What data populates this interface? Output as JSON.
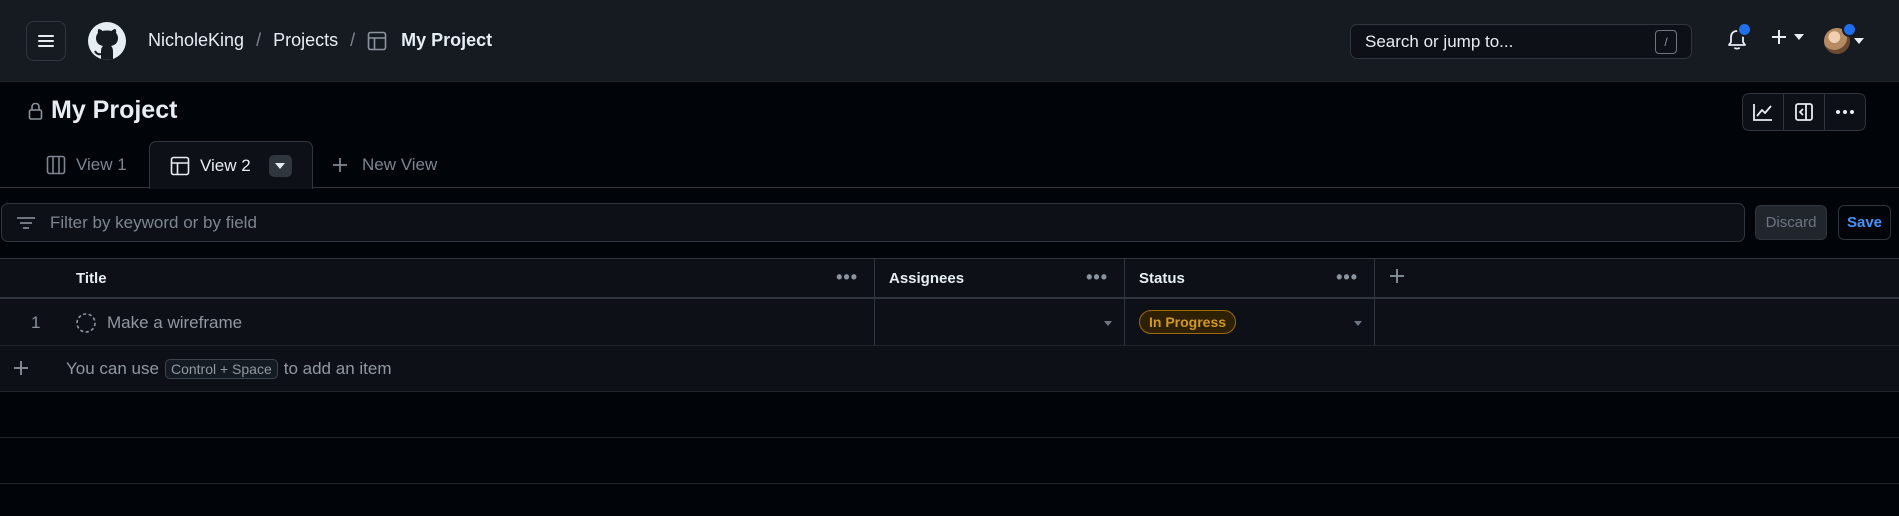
{
  "header": {
    "breadcrumbs": [
      "NicholeKing",
      "Projects",
      "My Project"
    ],
    "search_placeholder": "Search or jump to...",
    "search_shortcut": "/",
    "icons": [
      "hamburger-icon",
      "github-logo-icon",
      "table-icon",
      "bell-icon",
      "plus-icon",
      "chevron-down-icon",
      "avatar"
    ]
  },
  "project": {
    "title": "My Project",
    "visibility_icon": "lock-icon",
    "toolbar_icons": [
      "insights-icon",
      "sidebar-panel-icon",
      "kebab-horizontal-icon"
    ]
  },
  "views": {
    "tabs": [
      {
        "label": "View 1",
        "icon": "board-icon",
        "active": false
      },
      {
        "label": "View 2",
        "icon": "table-icon",
        "active": true
      }
    ],
    "new_view_label": "New View"
  },
  "filter": {
    "placeholder": "Filter by keyword or by field",
    "discard_label": "Discard",
    "save_label": "Save"
  },
  "table": {
    "columns": [
      "Title",
      "Assignees",
      "Status"
    ],
    "rows": [
      {
        "number": "1",
        "title": "Make a wireframe",
        "assignees": "",
        "status": "In Progress"
      }
    ],
    "add_hint": {
      "prefix": "You can use",
      "shortcut": "Control + Space",
      "suffix": "to add an item"
    }
  },
  "colors": {
    "background": "#010409",
    "header_bg": "#161b22",
    "accent": "#4493f8",
    "status_in_progress": "#d29922",
    "notification_dot": "#1f6feb"
  }
}
